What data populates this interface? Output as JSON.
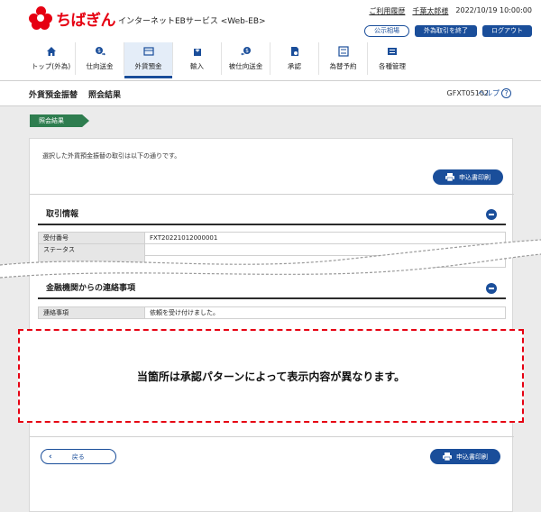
{
  "header": {
    "brand": "ちばぎん",
    "service": "インターネットEBサービス <Web-EB>",
    "links": {
      "usage_history": "ご利用履歴",
      "user_name": "千葉太郎様",
      "datetime": "2022/10/19 10:00:00"
    },
    "buttons": {
      "rates": "公示相場",
      "end_fx": "外為取引を終了",
      "logout": "ログアウト"
    }
  },
  "nav": [
    {
      "label": "トップ(外為)",
      "icon": "home-icon"
    },
    {
      "label": "仕向送金",
      "icon": "outgoing-remittance-icon"
    },
    {
      "label": "外貨預金",
      "icon": "fx-deposit-icon",
      "active": true
    },
    {
      "label": "輸入",
      "icon": "import-icon"
    },
    {
      "label": "被仕向送金",
      "icon": "incoming-remittance-icon"
    },
    {
      "label": "承認",
      "icon": "approval-icon"
    },
    {
      "label": "為替予約",
      "icon": "fx-contract-icon"
    },
    {
      "label": "各種管理",
      "icon": "management-icon"
    }
  ],
  "page": {
    "title_main": "外貨預金振替",
    "title_sub": "照会結果",
    "screen_id": "GFXT05102",
    "help": "ヘルプ",
    "step": "照会結果"
  },
  "content": {
    "intro": "選択した外貨預金振替の取引は以下の通りです。",
    "print_button": "申込書印刷",
    "section1": {
      "title": "取引情報",
      "rows": [
        {
          "label": "受付番号",
          "value": "FXT20221012000001"
        },
        {
          "label": "ステータス",
          "value": ""
        }
      ]
    },
    "section2": {
      "title": "金融機関からの連絡事項",
      "rows": [
        {
          "label": "連絡事項",
          "value": "依頼を受け付けました。"
        }
      ]
    },
    "notice": "当箇所は承認パターンによって表示内容が異なります。",
    "back_button": "戻る"
  },
  "colors": {
    "brand": "#e60012",
    "primary": "#1a4e9a",
    "step": "#2e7d4f"
  }
}
